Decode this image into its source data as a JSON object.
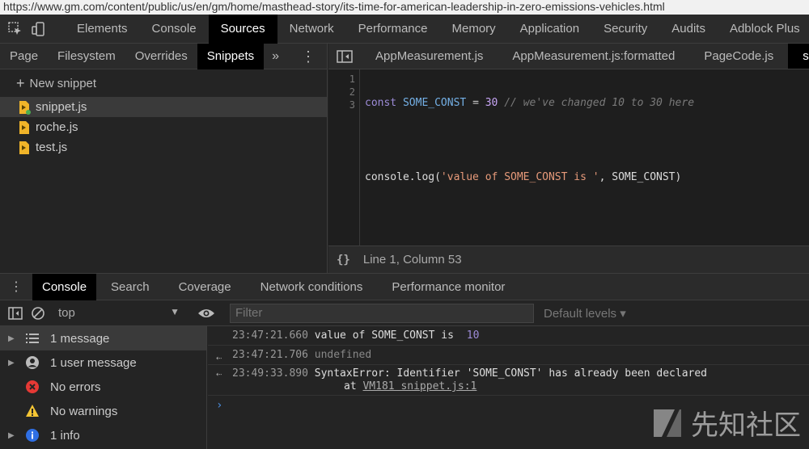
{
  "url": "https://www.gm.com/content/public/us/en/gm/home/masthead-story/its-time-for-american-leadership-in-zero-emissions-vehicles.html",
  "main_tabs": [
    "Elements",
    "Console",
    "Sources",
    "Network",
    "Performance",
    "Memory",
    "Application",
    "Security",
    "Audits",
    "Adblock Plus"
  ],
  "active_main_tab": "Sources",
  "sources": {
    "sub_tabs": [
      "Page",
      "Filesystem",
      "Overrides",
      "Snippets"
    ],
    "more": "»",
    "new_snippet": "New snippet",
    "files": [
      "snippet.js",
      "roche.js",
      "test.js"
    ]
  },
  "editor": {
    "tabs": [
      "AppMeasurement.js",
      "AppMeasurement.js:formatted",
      "PageCode.js",
      "snip"
    ],
    "line_numbers": [
      "1",
      "2",
      "3"
    ],
    "code": {
      "l1_kw": "const",
      "l1_name": "SOME_CONST",
      "l1_op": "=",
      "l1_num": "30",
      "l1_comment": "// we've changed 10 to 30 here",
      "l3_obj": "console.log(",
      "l3_str": "'value of SOME_CONST is '",
      "l3_rest": ", SOME_CONST)"
    },
    "status": "Line 1, Column 53",
    "braces": "{}"
  },
  "drawer": {
    "tabs": [
      "Console",
      "Search",
      "Coverage",
      "Network conditions",
      "Performance monitor"
    ],
    "context": "top",
    "filter_placeholder": "Filter",
    "levels": "Default levels ▾"
  },
  "sidebar": {
    "items": [
      "1 message",
      "1 user message",
      "No errors",
      "No warnings",
      "1 info"
    ]
  },
  "console": {
    "line1_ts": "23:47:21.660",
    "line1_text": "value of SOME_CONST is ",
    "line1_value": "10",
    "line2_ts": "23:47:21.706",
    "line2_text": "undefined",
    "line3_ts": "23:49:33.890",
    "line3_text": "SyntaxError: Identifier 'SOME_CONST' has already been declared",
    "line3_at": "at",
    "line3_link": "VM181 snippet.js:1",
    "prompt": "›"
  },
  "watermark": "先知社区",
  "colors": {
    "accent_blue": "#4b8fe0",
    "error_red": "#e53935",
    "warning_yellow": "#f4c534",
    "info_blue": "#2f6fe4",
    "file_icon": "#f0b429"
  }
}
